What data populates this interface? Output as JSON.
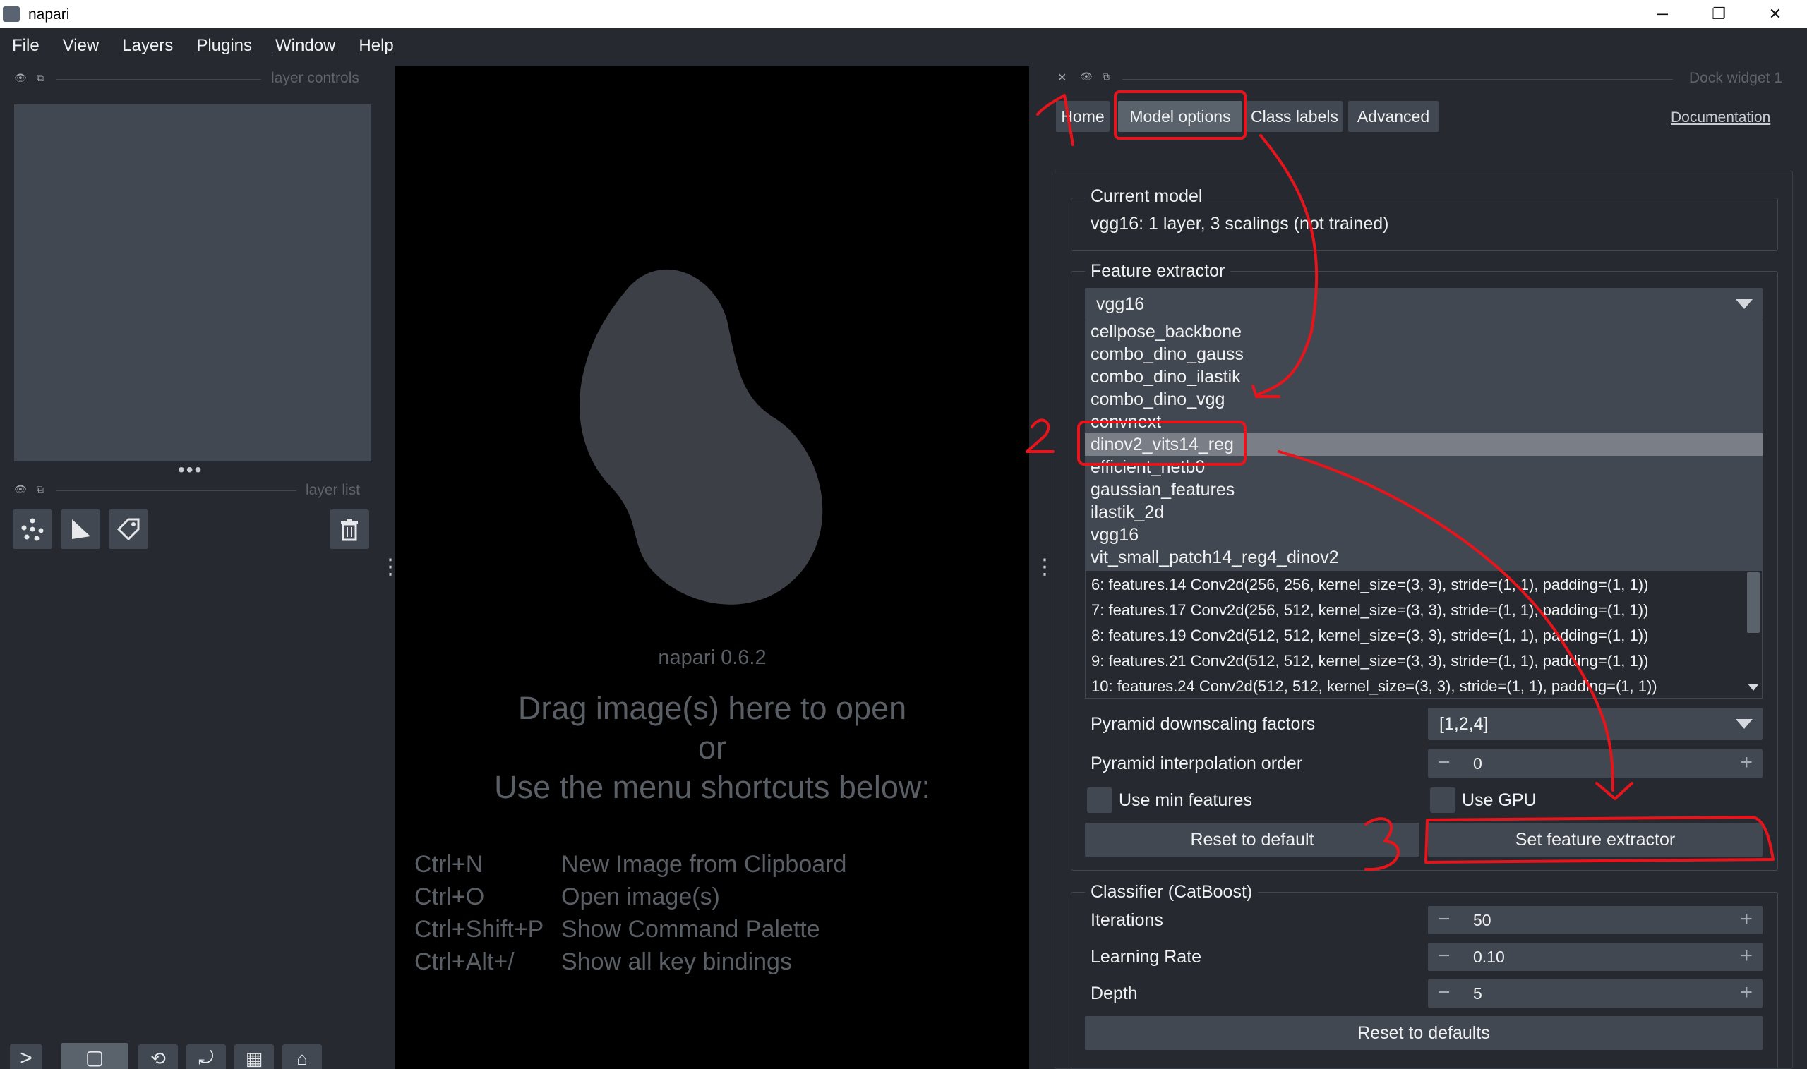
{
  "window": {
    "title": "napari",
    "buttons": {
      "minimize": "─",
      "restore": "❐",
      "close": "✕"
    }
  },
  "menu": [
    "File",
    "View",
    "Layers",
    "Plugins",
    "Window",
    "Help"
  ],
  "left": {
    "layer_controls_title": "layer controls",
    "layer_list_title": "layer list",
    "tools": [
      "points-icon",
      "shapes-icon",
      "labels-icon",
      "trash-icon"
    ]
  },
  "canvas": {
    "version": "napari 0.6.2",
    "drag_line1": "Drag image(s) here to open",
    "drag_or": "or",
    "drag_line3": "Use the menu shortcuts below:",
    "shortcuts": [
      {
        "key": "Ctrl+N",
        "desc": "New Image from Clipboard"
      },
      {
        "key": "Ctrl+O",
        "desc": "Open image(s)"
      },
      {
        "key": "Ctrl+Shift+P",
        "desc": "Show Command Palette"
      },
      {
        "key": "Ctrl+Alt+/",
        "desc": "Show all key bindings"
      }
    ]
  },
  "dock": {
    "title": "Dock widget 1",
    "tabs": [
      "Home",
      "Model options",
      "Class labels",
      "Advanced"
    ],
    "active_tab": "Model options",
    "documentation": "Documentation",
    "current_model_label": "Current model",
    "current_model_value": "vgg16: 1 layer, 3 scalings (not trained)",
    "feature_extractor_label": "Feature extractor",
    "feature_extractor_selected": "vgg16",
    "feature_extractor_options": [
      "cellpose_backbone",
      "combo_dino_gauss",
      "combo_dino_ilastik",
      "combo_dino_vgg",
      "convnext",
      "dinov2_vits14_reg",
      "efficient_netb0",
      "gaussian_features",
      "ilastik_2d",
      "vgg16",
      "vit_small_patch14_reg4_dinov2"
    ],
    "highlighted_option": "dinov2_vits14_reg",
    "layers": [
      "6: features.14 Conv2d(256, 256, kernel_size=(3, 3), stride=(1, 1), padding=(1, 1))",
      "7: features.17 Conv2d(256, 512, kernel_size=(3, 3), stride=(1, 1), padding=(1, 1))",
      "8: features.19 Conv2d(512, 512, kernel_size=(3, 3), stride=(1, 1), padding=(1, 1))",
      "9: features.21 Conv2d(512, 512, kernel_size=(3, 3), stride=(1, 1), padding=(1, 1))",
      "10: features.24 Conv2d(512, 512, kernel_size=(3, 3), stride=(1, 1), padding=(1, 1))"
    ],
    "pyramid_factors_label": "Pyramid downscaling factors",
    "pyramid_factors_value": "[1,2,4]",
    "pyramid_order_label": "Pyramid interpolation order",
    "pyramid_order_value": "0",
    "use_min_features_label": "Use min features",
    "use_gpu_label": "Use GPU",
    "reset_default_label": "Reset to default",
    "set_extractor_label": "Set feature extractor",
    "classifier_label": "Classifier (CatBoost)",
    "iterations_label": "Iterations",
    "iterations_value": "50",
    "learning_rate_label": "Learning Rate",
    "learning_rate_value": "0.10",
    "depth_label": "Depth",
    "depth_value": "5",
    "reset_defaults_label": "Reset to defaults"
  },
  "annotations": {
    "step1": "1",
    "step2": "2",
    "step3": "3",
    "color": "#e8141c"
  }
}
